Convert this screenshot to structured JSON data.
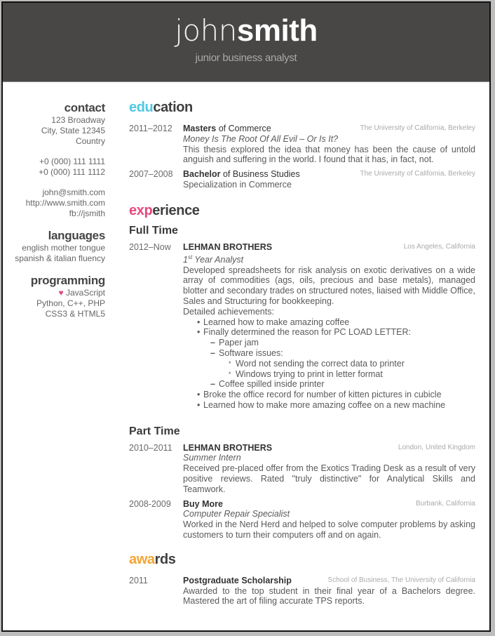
{
  "header": {
    "first_name": "john",
    "last_name": "smith",
    "subtitle": "junior business analyst"
  },
  "sidebar": {
    "contact": {
      "title": "contact",
      "address": [
        "123 Broadway",
        "City, State 12345",
        "Country"
      ],
      "phones": [
        "+0 (000) 111 1111",
        "+0 (000) 111 1112"
      ],
      "online": [
        "john@smith.com",
        "http://www.smith.com",
        "fb://jsmith"
      ]
    },
    "languages": {
      "title": "languages",
      "items": [
        "english mother tongue",
        "spanish & italian fluency"
      ]
    },
    "programming": {
      "title": "programming",
      "heart_icon": "♥",
      "items": [
        "JavaScript",
        "Python, C++, PHP",
        "CSS3 & HTML5"
      ]
    }
  },
  "colors": {
    "education": "#4fc8e1",
    "experience": "#e5487f",
    "awards": "#f3a534",
    "header_bg": "#484746"
  },
  "education": {
    "title_accent": "edu",
    "title_rest": "cation",
    "entries": [
      {
        "date": "2011–2012",
        "degree_bold": "Masters",
        "degree_rest": " of Commerce",
        "location": "The University of California, Berkeley",
        "thesis": "Money Is The Root Of All Evil – Or Is It?",
        "description": "This thesis explored the idea that money has been the cause of untold anguish and suffering in the world. I found that it has, in fact, not."
      },
      {
        "date": "2007–2008",
        "degree_bold": "Bachelor",
        "degree_rest": " of Business Studies",
        "location": "The University of California, Berkeley",
        "description": "Specialization in Commerce"
      }
    ]
  },
  "experience": {
    "title_accent": "exp",
    "title_rest": "erience",
    "full_time": {
      "title": "Full Time",
      "entries": [
        {
          "date": "2012–Now",
          "company": "LEHMAN BROTHERS",
          "location": "Los Angeles, California",
          "role_sup": "st",
          "role_pre": "1",
          "role_post": " Year Analyst",
          "description": "Developed spreadsheets for risk analysis on exotic derivatives on a wide array of commodities (ags, oils, precious and base metals), managed blotter and secondary trades on structured notes, liaised with Middle Office, Sales and Structuring for bookkeeping.",
          "achievements_label": "Detailed achievements:",
          "bullets": [
            "Learned how to make amazing coffee",
            "Finally determined the reason for PC LOAD LETTER:",
            "Broke the office record for number of kitten pictures in cubicle",
            "Learned how to make more amazing coffee on a new machine"
          ],
          "sub_bullets": [
            "Paper jam",
            "Software issues:",
            "Coffee spilled inside printer"
          ],
          "sub_sub_bullets": [
            "Word not sending the correct data to printer",
            "Windows trying to print in letter format"
          ]
        }
      ]
    },
    "part_time": {
      "title": "Part Time",
      "entries": [
        {
          "date": "2010–2011",
          "company": "LEHMAN BROTHERS",
          "location": "London, United Kingdom",
          "role": "Summer Intern",
          "description": "Received pre-placed offer from the Exotics Trading Desk as a result of very positive reviews. Rated \"truly distinctive\" for Analytical Skills and Teamwork."
        },
        {
          "date": "2008-2009",
          "company": "Buy More",
          "location": "Burbank, California",
          "role": "Computer Repair Specialist",
          "description": "Worked in the Nerd Herd and helped to solve computer problems by asking customers to turn their computers off and on again."
        }
      ]
    }
  },
  "awards": {
    "title_accent": "awa",
    "title_rest": "rds",
    "entries": [
      {
        "date": "2011",
        "name": "Postgraduate Scholarship",
        "location": "School of Business, The University of California",
        "description": "Awarded to the top student in their final year of a Bachelors degree. Mastered the art of filing accurate TPS reports."
      }
    ]
  }
}
